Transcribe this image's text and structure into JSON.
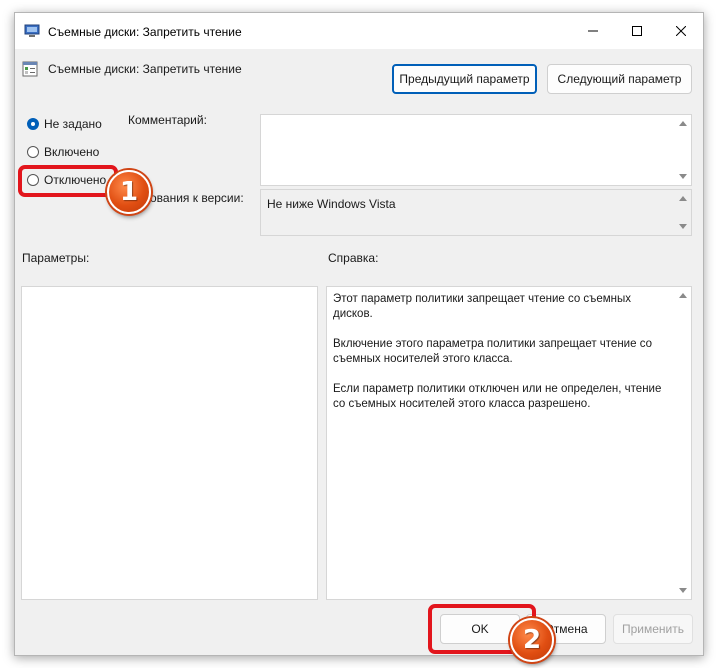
{
  "window": {
    "title": "Съемные диски: Запретить чтение",
    "controls": {
      "minimize_icon": "minimize-icon",
      "maximize_icon": "maximize-icon",
      "close_icon": "close-icon"
    }
  },
  "header": {
    "title": "Съемные диски: Запретить чтение"
  },
  "nav": {
    "prev_label": "Предыдущий параметр",
    "next_label": "Следующий параметр"
  },
  "state": {
    "options": [
      "Не задано",
      "Включено",
      "Отключено"
    ],
    "selected": "Не задано"
  },
  "comment": {
    "label": "Комментарий:",
    "value": ""
  },
  "supported": {
    "label": "ования к версии:",
    "value": "Не ниже Windows Vista"
  },
  "sections": {
    "options_label": "Параметры:",
    "help_label": "Справка:"
  },
  "help": {
    "paragraphs": [
      "Этот параметр политики запрещает чтение со съемных дисков.",
      "Включение этого параметра политики запрещает чтение со съемных носителей этого класса.",
      "Если параметр политики отключен или не определен, чтение со съемных носителей этого класса разрешено."
    ]
  },
  "footer": {
    "ok_label": "OK",
    "cancel_label": "Отмена",
    "apply_label": "Применить"
  },
  "annotations": {
    "badge1": "1",
    "badge2": "2",
    "accent": "#e2151c"
  },
  "colors": {
    "accent": "#005fb8",
    "window_bg": "#f0f0f0"
  }
}
